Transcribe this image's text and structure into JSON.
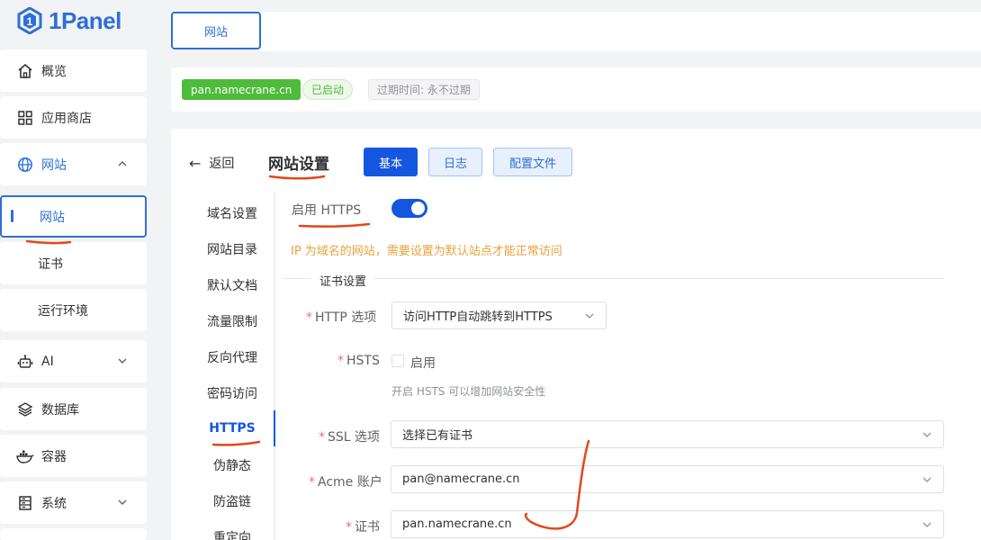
{
  "app": {
    "logo_text": "1Panel"
  },
  "sidebar": {
    "items": [
      {
        "label": "概览",
        "icon": "home-icon"
      },
      {
        "label": "应用商店",
        "icon": "grid-icon"
      },
      {
        "label": "网站",
        "icon": "globe-icon",
        "expanded": true
      },
      {
        "label": "AI",
        "icon": "robot-icon"
      },
      {
        "label": "数据库",
        "icon": "layers-icon"
      },
      {
        "label": "容器",
        "icon": "docker-icon"
      },
      {
        "label": "系统",
        "icon": "server-icon"
      }
    ],
    "sub_items": [
      {
        "label": "网站",
        "active": true
      },
      {
        "label": "证书"
      },
      {
        "label": "运行环境"
      }
    ]
  },
  "topbar": {
    "tab_label": "网站"
  },
  "infobar": {
    "domain": "pan.namecrane.cn",
    "status": "已启动",
    "expire": "过期时间: 永不过期"
  },
  "header": {
    "back_label": "返回",
    "title": "网站设置",
    "buttons": [
      "基本",
      "日志",
      "配置文件"
    ]
  },
  "subnav": {
    "items": [
      "域名设置",
      "网站目录",
      "默认文档",
      "流量限制",
      "反向代理",
      "密码访问",
      "HTTPS",
      "伪静态",
      "防盗链",
      "重定向"
    ],
    "active": "HTTPS"
  },
  "form": {
    "https_label": "启用 HTTPS",
    "https_enabled": true,
    "warning": "IP 为域名的网站，需要设置为默认站点才能正常访问",
    "section_title": "证书设置",
    "http_option_label": "HTTP 选项",
    "http_option_value": "访问HTTP自动跳转到HTTPS",
    "hsts_label": "HSTS",
    "hsts_checkbox_label": "启用",
    "hsts_hint": "开启 HSTS 可以增加网站安全性",
    "ssl_label": "SSL 选项",
    "ssl_value": "选择已有证书",
    "acme_label": "Acme 账户",
    "acme_value": "pan@namecrane.cn",
    "cert_label": "证书",
    "cert_value": "pan.namecrane.cn"
  },
  "colors": {
    "primary": "#1456e0",
    "success": "#4ebb3a",
    "warning": "#e6a23c",
    "annotation": "#e0481e"
  }
}
